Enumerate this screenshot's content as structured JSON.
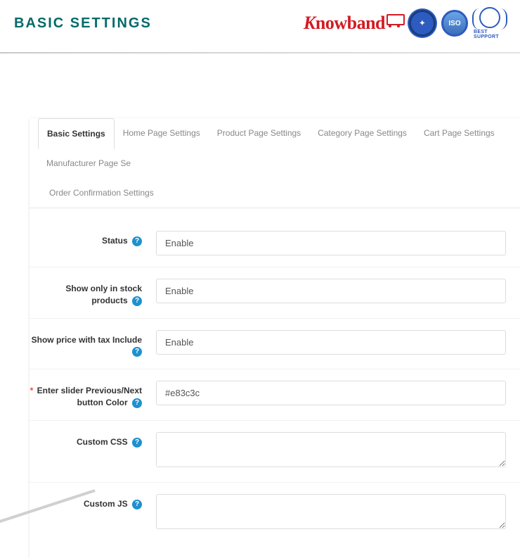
{
  "header": {
    "title": "BASIC SETTINGS",
    "logo_brand": "Knowband",
    "iso_label": "ISO",
    "best_support_label": "BEST SUPPORT"
  },
  "tabs": [
    {
      "label": "Basic Settings",
      "active": true
    },
    {
      "label": "Home Page Settings",
      "active": false
    },
    {
      "label": "Product Page Settings",
      "active": false
    },
    {
      "label": "Category Page Settings",
      "active": false
    },
    {
      "label": "Cart Page Settings",
      "active": false
    },
    {
      "label": "Manufacturer Page Se",
      "active": false
    },
    {
      "label": "Order Confirmation Settings",
      "active": false
    }
  ],
  "fields": {
    "status": {
      "label": "Status",
      "value": "Enable",
      "required": false,
      "type": "select"
    },
    "stock": {
      "label": "Show only in stock products",
      "value": "Enable",
      "required": false,
      "type": "select"
    },
    "tax": {
      "label": "Show price with tax Include",
      "value": "Enable",
      "required": false,
      "type": "select"
    },
    "color": {
      "label": "Enter slider Previous/Next button Color",
      "value": "#e83c3c",
      "required": true,
      "type": "text"
    },
    "css": {
      "label": "Custom CSS",
      "value": "",
      "required": false,
      "type": "textarea"
    },
    "js": {
      "label": "Custom JS",
      "value": "",
      "required": false,
      "type": "textarea"
    }
  },
  "hint_char": "?"
}
